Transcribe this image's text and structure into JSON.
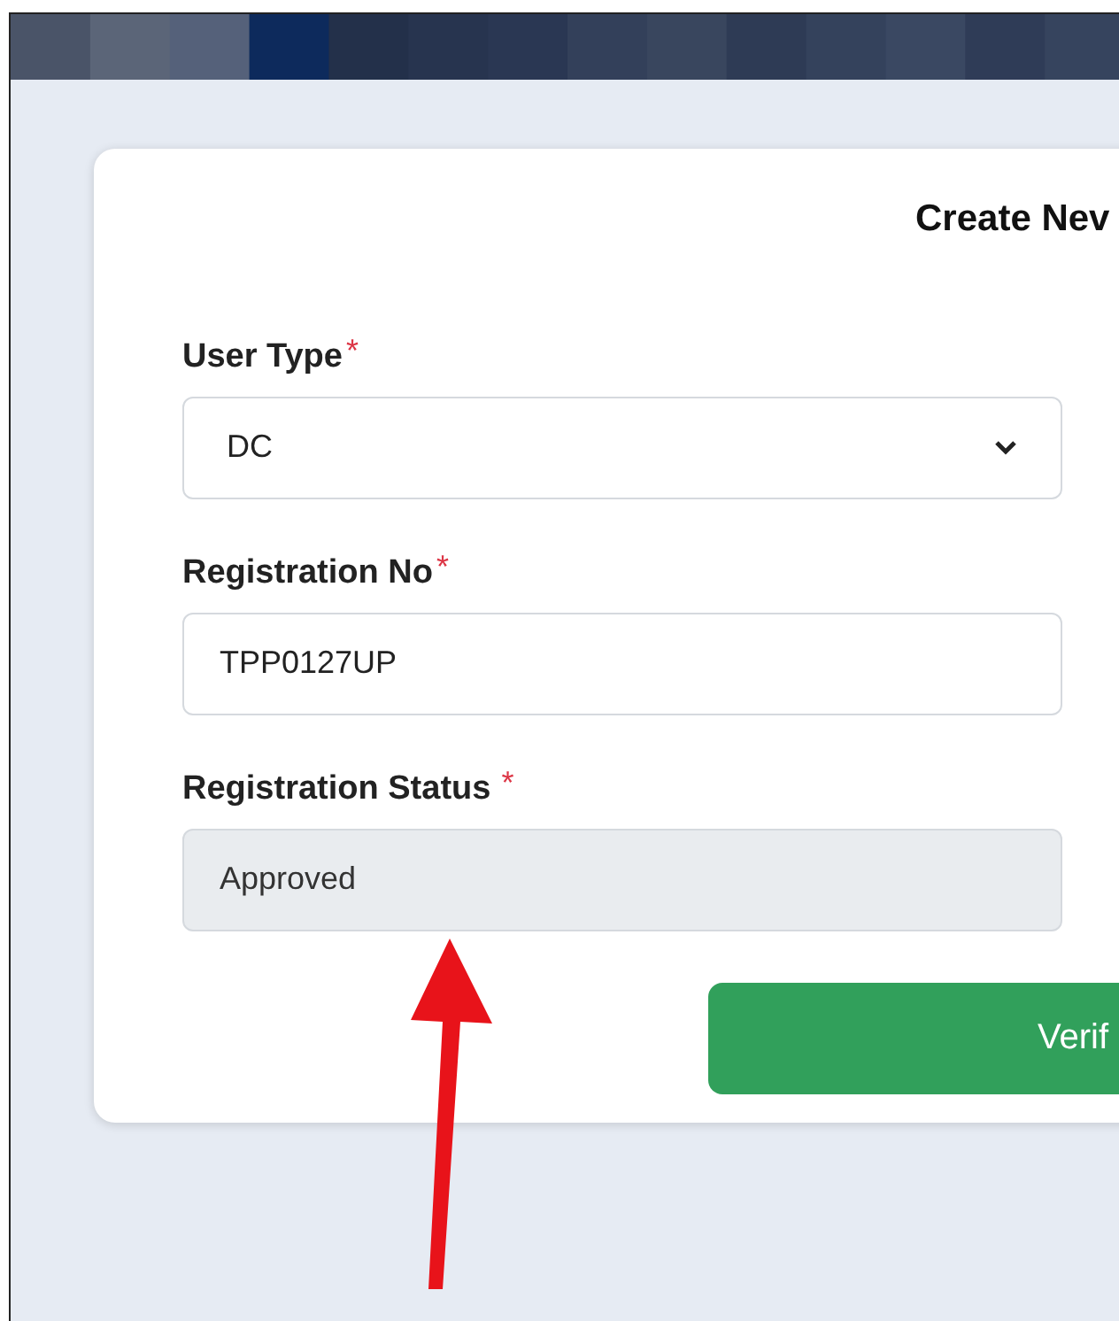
{
  "page_title": "Create Nev",
  "fields": [
    {
      "label": "User Type",
      "required_mark": "*",
      "kind": "select",
      "value": "DC"
    },
    {
      "label": "Registration No",
      "required_mark": "*",
      "kind": "input",
      "value": "TPP0127UP"
    },
    {
      "label": "Registration Status",
      "required_mark": "*",
      "kind": "readonly",
      "value": "Approved"
    }
  ],
  "button": "Verif"
}
